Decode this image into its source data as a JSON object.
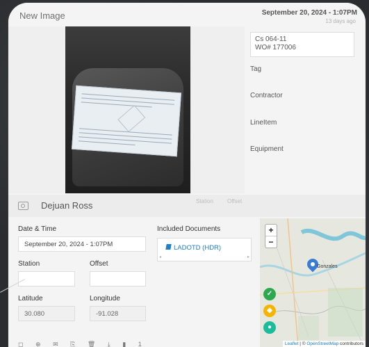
{
  "header": {
    "title": "New Image",
    "datetime": "September 20, 2024 - 1:07PM",
    "relative": "13 days ago"
  },
  "photo": {
    "alt": "vehicle seat with work order document"
  },
  "details": {
    "wo_text_line1": "Cs 064-11",
    "wo_text_line2": "WO# 177006",
    "tag_label": "Tag",
    "contractor_label": "Contractor",
    "lineitem_label": "LineItem",
    "equipment_label": "Equipment"
  },
  "faded_labels": {
    "station": "Station",
    "offset": "Offset"
  },
  "user": {
    "name": "Dejuan Ross",
    "icon": "camera-icon"
  },
  "form": {
    "datetime_label": "Date & Time",
    "datetime_value": "September 20, 2024 - 1:07PM",
    "station_label": "Station",
    "station_value": "",
    "offset_label": "Offset",
    "offset_value": "",
    "latitude_label": "Latitude",
    "latitude_value": "30.080",
    "longitude_label": "Longitude",
    "longitude_value": "-91.028",
    "documents_label": "Included Documents",
    "documents": [
      "LADOTD (HDR)"
    ],
    "scroll_left": "◂",
    "scroll_right": "▸"
  },
  "map": {
    "zoom_in": "+",
    "zoom_out": "−",
    "town": "Gonzales",
    "attribution_leaflet": "Leaflet",
    "attribution_sep": " | © ",
    "attribution_osm": "OpenStreetMap",
    "attribution_rest": " contributors",
    "status_colors": {
      "check": "#2ea84f",
      "warn": "#f5b400",
      "pin": "#1abc9c"
    }
  },
  "toolbar": {
    "icons": [
      "square-icon",
      "zoom-icon",
      "mail-icon",
      "copy-icon",
      "trash-icon",
      "download-icon",
      "documents-icon"
    ],
    "glyphs": [
      "◻",
      "⊕",
      "✉",
      "⎘",
      "🗑",
      "⤓",
      "▮"
    ],
    "doc_count": "1"
  }
}
